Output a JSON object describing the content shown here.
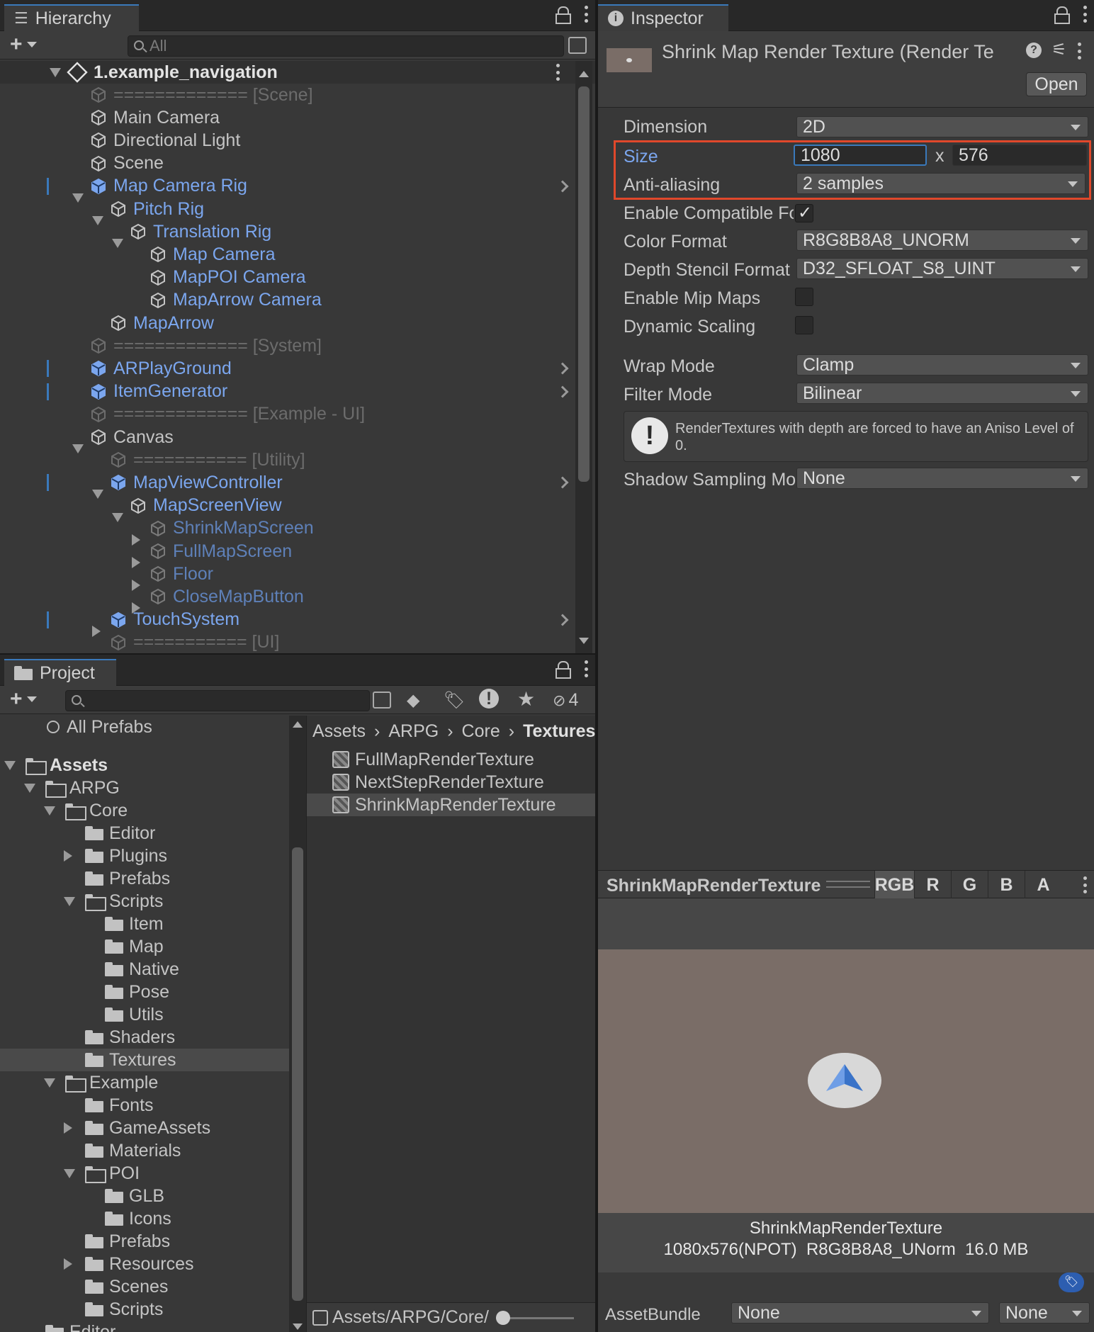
{
  "colors": {
    "accent": "#3a79bb",
    "prefab_blue": "#7ba6ee",
    "highlight_red": "#e0482b",
    "preview_bg": "#7a6d67"
  },
  "hierarchy": {
    "tab_label": "Hierarchy",
    "search_placeholder": "All",
    "scene_name": "1.example_navigation",
    "items": [
      "============= [Scene]",
      "Main Camera",
      "Directional Light",
      "Scene",
      "Map Camera Rig",
      "Pitch Rig",
      "Translation Rig",
      "Map Camera",
      "MapPOI Camera",
      "MapArrow Camera",
      "MapArrow",
      "============= [System]",
      "ARPlayGround",
      "ItemGenerator",
      "============= [Example - UI]",
      "Canvas",
      "=========== [Utility]",
      "MapViewController",
      "MapScreenView",
      "ShrinkMapScreen",
      "FullMapScreen",
      "Floor",
      "CloseMapButton",
      "TouchSystem",
      "=========== [UI]"
    ]
  },
  "project": {
    "tab_label": "Project",
    "hidden_count": "4",
    "all_prefabs": "All Prefabs",
    "tree": [
      "Assets",
      "ARPG",
      "Core",
      "Editor",
      "Plugins",
      "Prefabs",
      "Scripts",
      "Item",
      "Map",
      "Native",
      "Pose",
      "Utils",
      "Shaders",
      "Textures",
      "Example",
      "Fonts",
      "GameAssets",
      "Materials",
      "POI",
      "GLB",
      "Icons",
      "Prefabs",
      "Resources",
      "Scenes",
      "Scripts",
      "Editor"
    ],
    "breadcrumb": [
      "Assets",
      "ARPG",
      "Core",
      "Textures"
    ],
    "files": [
      "FullMapRenderTexture",
      "NextStepRenderTexture",
      "ShrinkMapRenderTexture"
    ],
    "footer_path": "Assets/ARPG/Core/"
  },
  "inspector": {
    "tab_label": "Inspector",
    "title": "Shrink Map Render Texture (Render Te",
    "open_label": "Open",
    "dimension_label": "Dimension",
    "dimension_value": "2D",
    "size_label": "Size",
    "size_w": "1080",
    "size_x": "x",
    "size_h": "576",
    "aa_label": "Anti-aliasing",
    "aa_value": "2 samples",
    "compat_label": "Enable Compatible Fo",
    "color_format_label": "Color Format",
    "color_format_value": "R8G8B8A8_UNORM",
    "depth_label": "Depth Stencil Format",
    "depth_value": "D32_SFLOAT_S8_UINT",
    "mip_label": "Enable Mip Maps",
    "dyn_label": "Dynamic Scaling",
    "wrap_label": "Wrap Mode",
    "wrap_value": "Clamp",
    "filter_label": "Filter Mode",
    "filter_value": "Bilinear",
    "warning": "RenderTextures with depth are forced to have an Aniso Level of 0.",
    "shadow_label": "Shadow Sampling Mo",
    "shadow_value": "None"
  },
  "preview": {
    "title": "ShrinkMapRenderTexture",
    "channels": [
      "RGB",
      "R",
      "G",
      "B",
      "A"
    ],
    "caption_name": "ShrinkMapRenderTexture",
    "caption_info": "1080x576(NPOT)  R8G8B8A8_UNorm  16.0 MB",
    "assetbundle_label": "AssetBundle",
    "assetbundle_value": "None",
    "variant_value": "None"
  }
}
